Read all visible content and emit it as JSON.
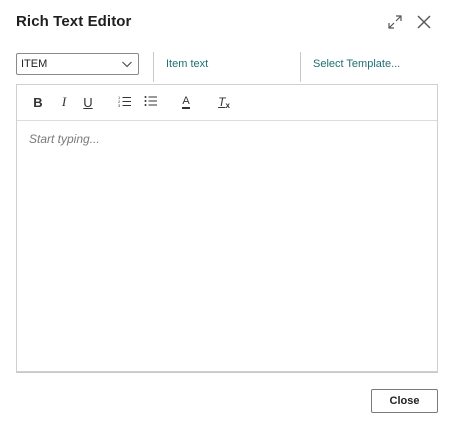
{
  "dialog": {
    "title": "Rich Text Editor"
  },
  "header_controls": {
    "expand_icon": "expand-icon",
    "close_icon": "close-icon"
  },
  "fields": {
    "type_select": {
      "value": "ITEM",
      "icon": "chevron-down-icon"
    },
    "item_text_link": "Item text",
    "template_link": "Select Template..."
  },
  "toolbar": {
    "bold": "B",
    "italic": "I",
    "underline": "U",
    "ordered_list_icon": "ordered-list-icon",
    "bullet_list_icon": "bullet-list-icon",
    "font_color": "A",
    "clear_format": "T"
  },
  "editor": {
    "placeholder": "Start typing..."
  },
  "footer": {
    "close_label": "Close"
  },
  "colors": {
    "link": "#1f6f74",
    "border": "#c8c8c8",
    "text": "#212121",
    "placeholder": "#7a7a7a"
  }
}
